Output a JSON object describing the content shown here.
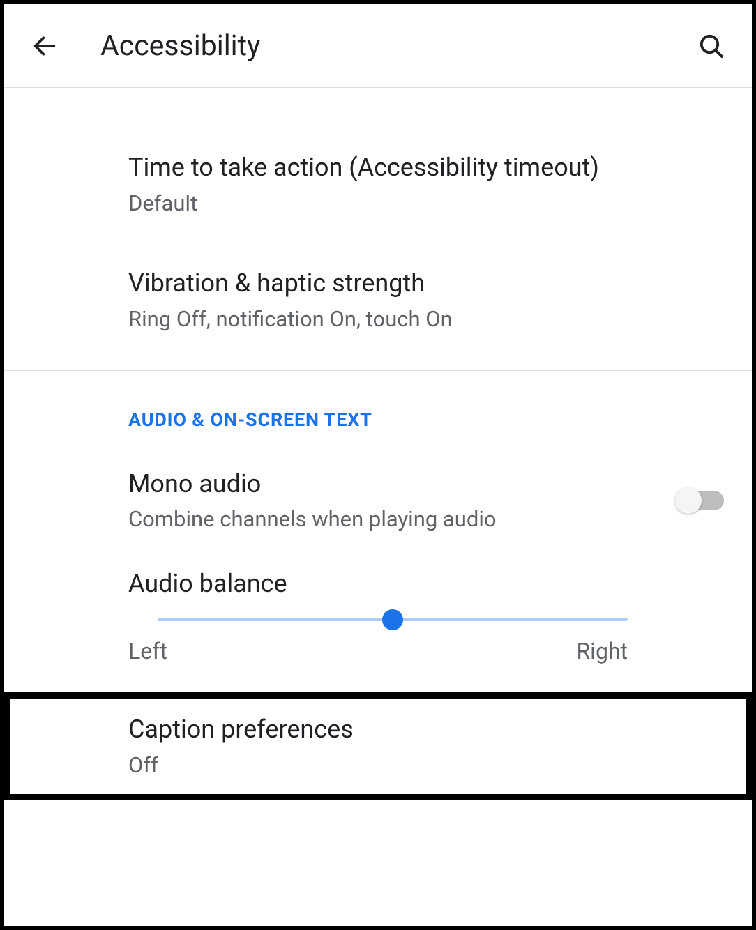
{
  "header": {
    "title": "Accessibility"
  },
  "items": {
    "timeout": {
      "title": "Time to take action (Accessibility timeout)",
      "subtitle": "Default"
    },
    "vibration": {
      "title": "Vibration & haptic strength",
      "subtitle": "Ring Off, notification On, touch On"
    }
  },
  "section": {
    "title": "Audio & on-screen text"
  },
  "mono": {
    "title": "Mono audio",
    "subtitle": "Combine channels when playing audio",
    "enabled": false
  },
  "balance": {
    "title": "Audio balance",
    "left_label": "Left",
    "right_label": "Right",
    "value": 50
  },
  "caption": {
    "title": "Caption preferences",
    "subtitle": "Off"
  },
  "colors": {
    "accent": "#1a73e8",
    "text_primary": "#202124",
    "text_secondary": "#5f6368",
    "slider_track": "#aecbfa"
  }
}
